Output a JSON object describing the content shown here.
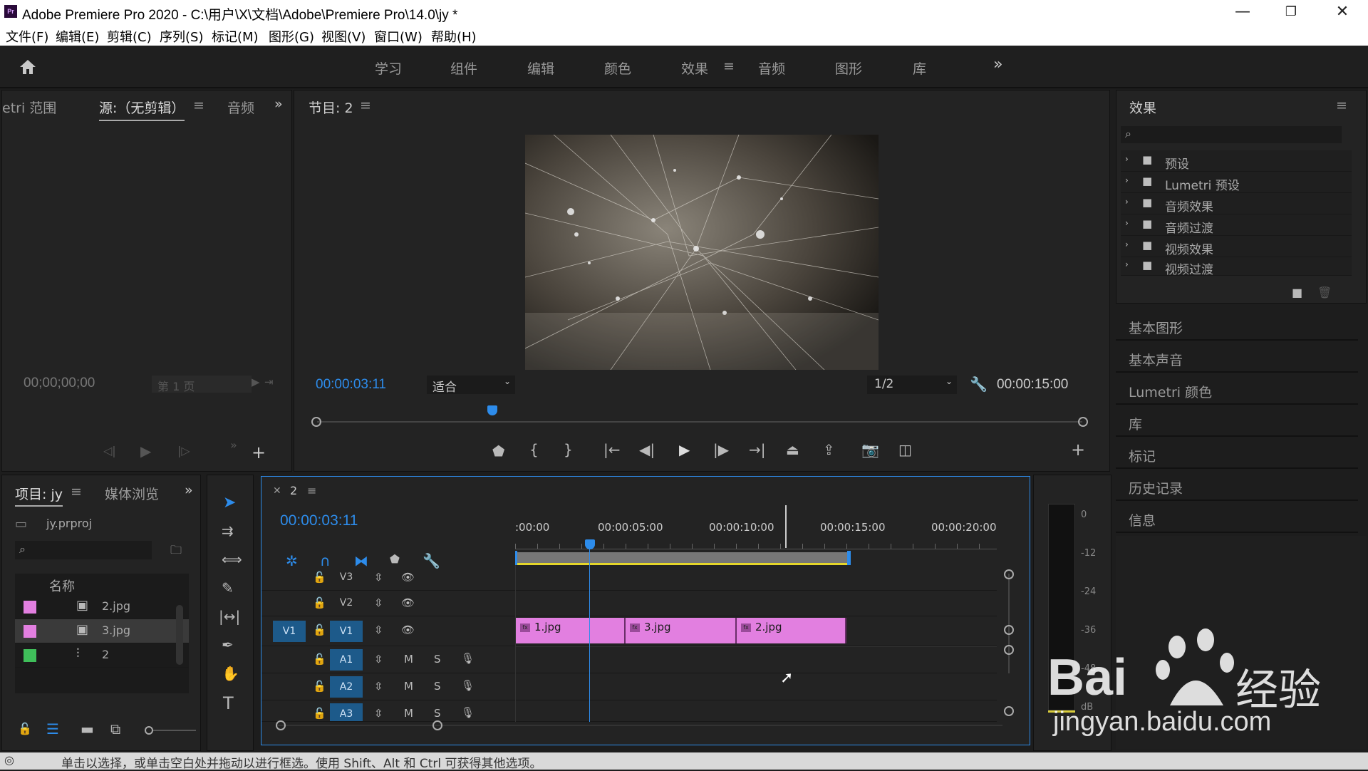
{
  "window": {
    "title": "Adobe Premiere Pro 2020 - C:\\用户\\X\\文档\\Adobe\\Premiere Pro\\14.0\\jy *",
    "logo": "Pr",
    "min": "—",
    "max": "❐",
    "close": "✕"
  },
  "menu": [
    "文件(F)",
    "编辑(E)",
    "剪辑(C)",
    "序列(S)",
    "标记(M)",
    "图形(G)",
    "视图(V)",
    "窗口(W)",
    "帮助(H)"
  ],
  "workspaces": {
    "home_icon": "home-icon",
    "tabs": [
      "学习",
      "组件",
      "编辑",
      "颜色",
      "效果",
      "音频",
      "图形",
      "库"
    ],
    "active": "效果",
    "more": "»"
  },
  "source_panel": {
    "tabs": [
      "etri 范围",
      "源:（无剪辑）",
      "音频"
    ],
    "timecode": "00;00;00;00",
    "page": "第 1 页"
  },
  "program": {
    "title": "节目: 2",
    "timecode": "00:00:03:11",
    "fit": "适合",
    "resolution": "1/2",
    "duration": "00:00:15:00",
    "playhead_fraction": 0.23
  },
  "project": {
    "tabs": [
      "项目: jy",
      "媒体浏览"
    ],
    "file": "jy.prproj",
    "col_name": "名称",
    "items": [
      {
        "name": "2.jpg",
        "color": "#e27fe0"
      },
      {
        "name": "3.jpg",
        "color": "#e27fe0"
      },
      {
        "name": "2",
        "color": "#3fbf5a"
      }
    ]
  },
  "timeline": {
    "seq": "2",
    "timecode": "00:00:03:11",
    "ruler": [
      ":00:00",
      "00:00:05:00",
      "00:00:10:00",
      "00:00:15:00",
      "00:00:20:00"
    ],
    "tracks": [
      {
        "id": "V3",
        "src": ""
      },
      {
        "id": "V2",
        "src": ""
      },
      {
        "id": "V1",
        "src": "V1"
      },
      {
        "id": "A1",
        "src": ""
      },
      {
        "id": "A2",
        "src": ""
      },
      {
        "id": "A3",
        "src": ""
      }
    ],
    "clips": [
      {
        "name": "1.jpg"
      },
      {
        "name": "3.jpg"
      },
      {
        "name": "2.jpg"
      }
    ],
    "mute": "M",
    "solo": "S"
  },
  "meter": {
    "ticks": [
      "0",
      "-12",
      "-24",
      "-36",
      "-48"
    ],
    "unit": "dB"
  },
  "effects": {
    "title": "效果",
    "items": [
      "预设",
      "Lumetri 预设",
      "音频效果",
      "音频过渡",
      "视频效果",
      "视频过渡"
    ]
  },
  "side_panels": [
    "基本图形",
    "基本声音",
    "Lumetri 颜色",
    "库",
    "标记",
    "历史记录",
    "信息"
  ],
  "status": "单击以选择，或单击空白处并拖动以进行框选。使用 Shift、Alt 和 Ctrl 可获得其他选项。",
  "watermark": {
    "text1": "Bai",
    "text2": "经验",
    "url": "jingyan.baidu.com"
  }
}
